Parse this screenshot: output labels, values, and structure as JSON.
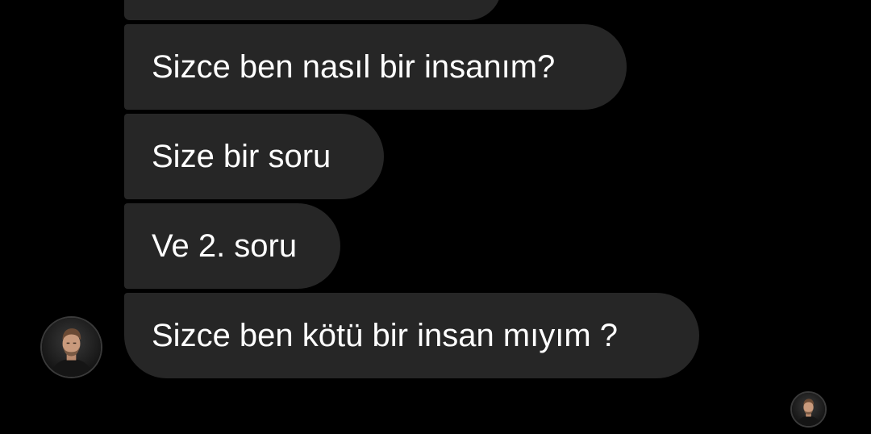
{
  "conversation": {
    "messages": [
      {
        "text": ""
      },
      {
        "text": "Sizce ben nasıl bir insanım?"
      },
      {
        "text": "Size bir soru"
      },
      {
        "text": "Ve 2. soru"
      },
      {
        "text": "Sizce ben kötü bir insan mıyım ?"
      }
    ],
    "sender_avatar_icon": "user-avatar",
    "read_receipt_icon": "user-avatar"
  },
  "colors": {
    "background": "#000000",
    "bubble": "#262626",
    "text": "#ffffff"
  }
}
